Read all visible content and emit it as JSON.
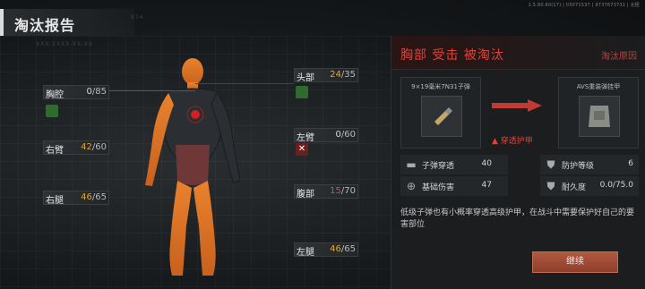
{
  "header": {
    "title": "淘汰报告",
    "version": "1.5.80.60(17) | 03071537 | 9737673731 | 北極"
  },
  "faint_text": {
    "top_num": "874",
    "left_small": "XXX-XXXX-XX-XX"
  },
  "body_parts": {
    "thorax": {
      "label": "胸腔",
      "current": "0",
      "max": "/85"
    },
    "head": {
      "label": "头部",
      "current": "24",
      "max": "/35"
    },
    "right_arm": {
      "label": "右臂",
      "current": "42",
      "max": "/60"
    },
    "left_arm": {
      "label": "左臂",
      "current": "0",
      "max": "/60"
    },
    "stomach": {
      "label": "腹部",
      "current": "15",
      "max": "/70"
    },
    "right_leg": {
      "label": "右腿",
      "current": "46",
      "max": "/65"
    },
    "left_leg": {
      "label": "左腿",
      "current": "46",
      "max": "/65"
    }
  },
  "report": {
    "headline": "胸部  受击  被淘汰",
    "reason": "淘汰原因",
    "ammo_name": "9×19毫米7N31子弹",
    "armor_name": "AVS重装弹挂甲",
    "penetration_tag": "穿透护甲",
    "stats": [
      {
        "icon": "bullet-icon",
        "label": "子弹穿透",
        "value": "40"
      },
      {
        "icon": "armor-class-icon",
        "label": "防护等级",
        "value": "6"
      },
      {
        "icon": "crosshair-icon",
        "label": "基础伤害",
        "value": "47"
      },
      {
        "icon": "durability-icon",
        "label": "耐久度",
        "value": "0.0/75.0"
      }
    ],
    "description": "低级子弹也有小概率穿透高级护甲，在战斗中需要保护好自己的要害部位",
    "continue_label": "继续"
  },
  "colors": {
    "accent_red": "#e0413a",
    "hp_yellow": "#e0a82e",
    "button": "#a14d36"
  }
}
